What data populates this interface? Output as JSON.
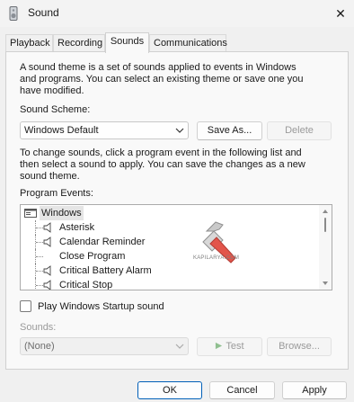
{
  "window": {
    "title": "Sound",
    "icon": "speaker-icon",
    "close_symbol": "✕"
  },
  "tabs": [
    {
      "label": "Playback",
      "active": false
    },
    {
      "label": "Recording",
      "active": false
    },
    {
      "label": "Sounds",
      "active": true
    },
    {
      "label": "Communications",
      "active": false
    }
  ],
  "sounds": {
    "intro_line1": "A sound theme is a set of sounds applied to events in Windows",
    "intro_line2": "and programs. You can select an existing theme or save one you",
    "intro_line3": "have modified.",
    "scheme_label": "Sound Scheme:",
    "scheme_value": "Windows Default",
    "save_as_label": "Save As...",
    "delete_label": "Delete",
    "change_line1": "To change sounds, click a program event in the following list and",
    "change_line2": "then select a sound to apply. You can save the changes as a new",
    "change_line3": "sound theme.",
    "events_label": "Program Events:",
    "events": {
      "root": "Windows",
      "items": [
        {
          "label": "Asterisk",
          "has_sound": true
        },
        {
          "label": "Calendar Reminder",
          "has_sound": true
        },
        {
          "label": "Close Program",
          "has_sound": false
        },
        {
          "label": "Critical Battery Alarm",
          "has_sound": true
        },
        {
          "label": "Critical Stop",
          "has_sound": true
        }
      ]
    },
    "startup_label": "Play Windows Startup sound",
    "startup_checked": false,
    "sounds_label": "Sounds:",
    "sounds_value": "(None)",
    "test_label": "Test",
    "browse_label": "Browse...",
    "watermark": "KAPILARYA.COM"
  },
  "footer": {
    "ok_label": "OK",
    "cancel_label": "Cancel",
    "apply_label": "Apply"
  },
  "colors": {
    "accent": "#005fb8",
    "panel": "#f9f9f9",
    "window": "#f0f0f0"
  }
}
